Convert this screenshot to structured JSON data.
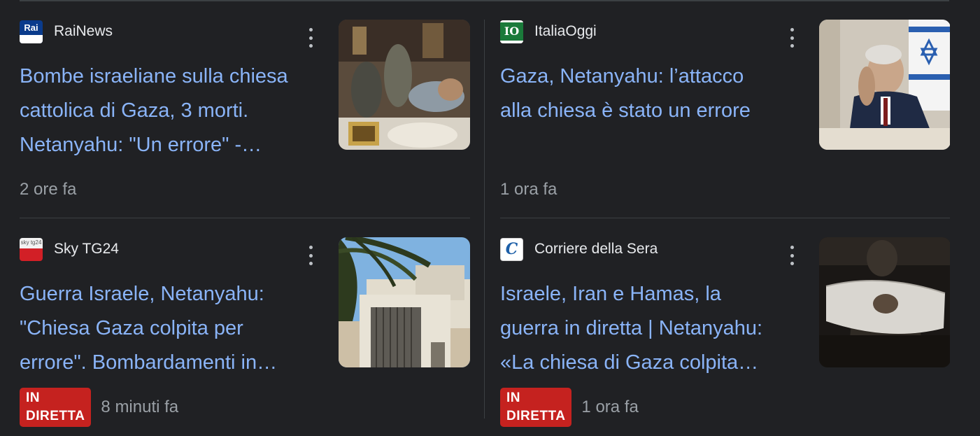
{
  "cards": [
    {
      "source": "RaiNews",
      "logo_text": "Rai",
      "headline_lines": [
        "Bombe israeliane sulla chiesa",
        "cattolica di Gaza, 3 morti.",
        "Netanyahu: \"Un errore\" -…"
      ],
      "live_label": "",
      "time": "2 ore fa"
    },
    {
      "source": "ItaliaOggi",
      "logo_text": "IO",
      "headline_lines": [
        "Gaza, Netanyahu: l’attacco",
        "alla chiesa è stato un errore"
      ],
      "live_label": "",
      "time": "1 ora fa"
    },
    {
      "source": "Sky TG24",
      "logo_text": "sky tg24",
      "headline_lines": [
        "Guerra Israele, Netanyahu:",
        "\"Chiesa Gaza colpita per",
        "errore\". Bombardamenti in…"
      ],
      "live_label": "IN DIRETTA",
      "time": "8 minuti fa"
    },
    {
      "source": "Corriere della Sera",
      "logo_text": "C",
      "headline_lines": [
        "Israele, Iran e Hamas, la",
        "guerra in diretta | Netanyahu:",
        "«La chiesa di Gaza colpita…"
      ],
      "live_label": "IN DIRETTA",
      "time": "1 ora fa"
    }
  ],
  "colors": {
    "background": "#202124",
    "headline": "#8ab4f8",
    "source_text": "#e8eaed",
    "timestamp": "#9aa0a6",
    "live_badge": "#c5221f",
    "divider": "#3c4043"
  },
  "icons": {
    "more": "more-vert-icon"
  }
}
